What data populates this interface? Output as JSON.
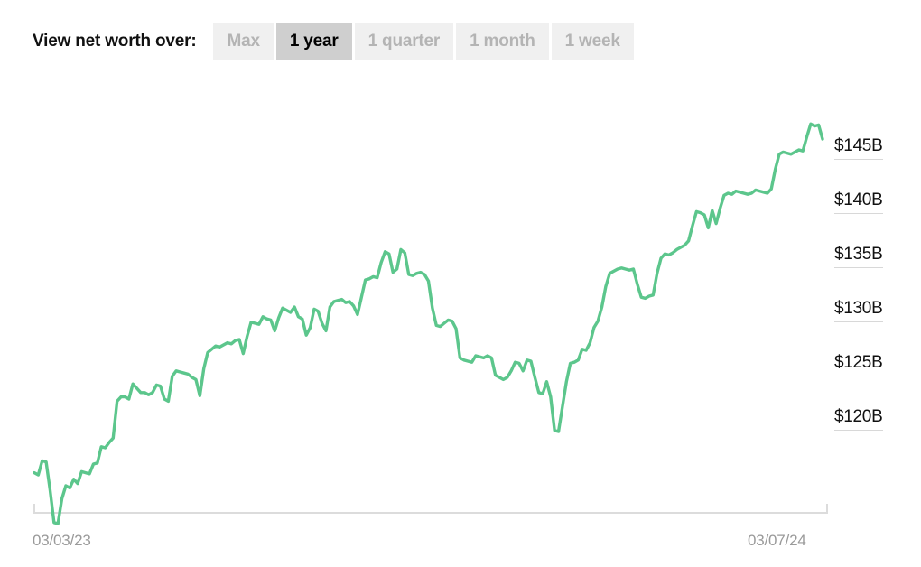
{
  "toolbar": {
    "label": "View net worth over:",
    "buttons": [
      {
        "label": "Max",
        "active": false
      },
      {
        "label": "1 year",
        "active": true
      },
      {
        "label": "1 quarter",
        "active": false
      },
      {
        "label": "1 month",
        "active": false
      },
      {
        "label": "1 week",
        "active": false
      }
    ]
  },
  "axis": {
    "y_ticks": [
      "$145B",
      "$140B",
      "$135B",
      "$130B",
      "$125B",
      "$120B"
    ],
    "x_start": "03/03/23",
    "x_end": "03/07/24"
  },
  "colors": {
    "line": "#5cc68c",
    "axis": "#dcdcdc",
    "tick_rule": "#d8d8d8",
    "button_inactive_bg": "#f0f0f0",
    "button_inactive_text": "#b4b4b4",
    "button_active_bg": "#cfcfcf",
    "button_active_text": "#000000",
    "x_label": "#9a9a9a",
    "y_label": "#111111"
  },
  "chart_data": {
    "type": "line",
    "title": "",
    "xlabel": "",
    "ylabel": "",
    "unit": "USD billions",
    "grid": false,
    "legend": false,
    "xlim": [
      "03/03/23",
      "03/07/24"
    ],
    "ylim": [
      111,
      149
    ],
    "ytick_values": [
      145,
      140,
      135,
      130,
      125,
      120
    ],
    "series": [
      {
        "name": "Net worth",
        "color": "#5cc68c",
        "values": [
          116.2,
          116.0,
          117.3,
          117.2,
          114.6,
          111.6,
          111.5,
          113.8,
          115.0,
          114.8,
          115.6,
          115.2,
          116.3,
          116.2,
          116.1,
          117.0,
          117.1,
          118.6,
          118.5,
          119.0,
          119.4,
          122.8,
          123.2,
          123.2,
          123.0,
          124.4,
          124.0,
          123.6,
          123.6,
          123.4,
          123.6,
          124.3,
          124.2,
          123.0,
          122.8,
          125.1,
          125.6,
          125.5,
          125.4,
          125.3,
          125.0,
          124.8,
          123.3,
          125.8,
          127.3,
          127.6,
          127.9,
          127.8,
          128.0,
          128.2,
          128.1,
          128.4,
          128.5,
          127.2,
          128.8,
          130.1,
          130.0,
          129.9,
          130.6,
          130.4,
          130.3,
          129.3,
          130.5,
          131.4,
          131.2,
          131.0,
          131.5,
          130.6,
          130.4,
          128.9,
          129.6,
          131.3,
          131.1,
          130.0,
          129.3,
          131.5,
          132.0,
          132.1,
          132.2,
          131.9,
          132.0,
          131.6,
          130.8,
          132.4,
          134.0,
          134.1,
          134.3,
          134.2,
          135.6,
          136.6,
          136.4,
          134.7,
          135.0,
          136.8,
          136.5,
          134.5,
          134.4,
          134.6,
          134.7,
          134.5,
          133.9,
          131.4,
          129.8,
          129.7,
          130.0,
          130.3,
          130.2,
          129.5,
          126.8,
          126.6,
          126.5,
          126.4,
          127.0,
          126.9,
          126.8,
          127.0,
          126.8,
          125.2,
          125.0,
          124.8,
          125.0,
          125.6,
          126.4,
          126.3,
          125.6,
          126.6,
          126.5,
          125.0,
          123.6,
          123.5,
          124.6,
          123.2,
          120.1,
          120.0,
          122.3,
          124.6,
          126.3,
          126.4,
          126.6,
          127.6,
          127.5,
          128.2,
          129.6,
          130.2,
          131.5,
          133.4,
          134.6,
          134.8,
          135.0,
          135.1,
          135.0,
          134.9,
          135.0,
          133.6,
          132.4,
          132.3,
          132.5,
          132.6,
          134.6,
          136.0,
          136.4,
          136.3,
          136.5,
          136.8,
          137.0,
          137.2,
          137.6,
          139.0,
          140.3,
          140.2,
          140.0,
          138.8,
          140.4,
          139.2,
          140.6,
          141.8,
          142.0,
          141.9,
          142.2,
          142.1,
          142.0,
          141.9,
          142.0,
          142.3,
          142.2,
          142.1,
          142.0,
          142.4,
          144.2,
          145.6,
          145.8,
          145.7,
          145.6,
          145.8,
          146.0,
          145.9,
          147.2,
          148.4,
          148.2,
          148.3,
          147.0
        ]
      }
    ]
  }
}
